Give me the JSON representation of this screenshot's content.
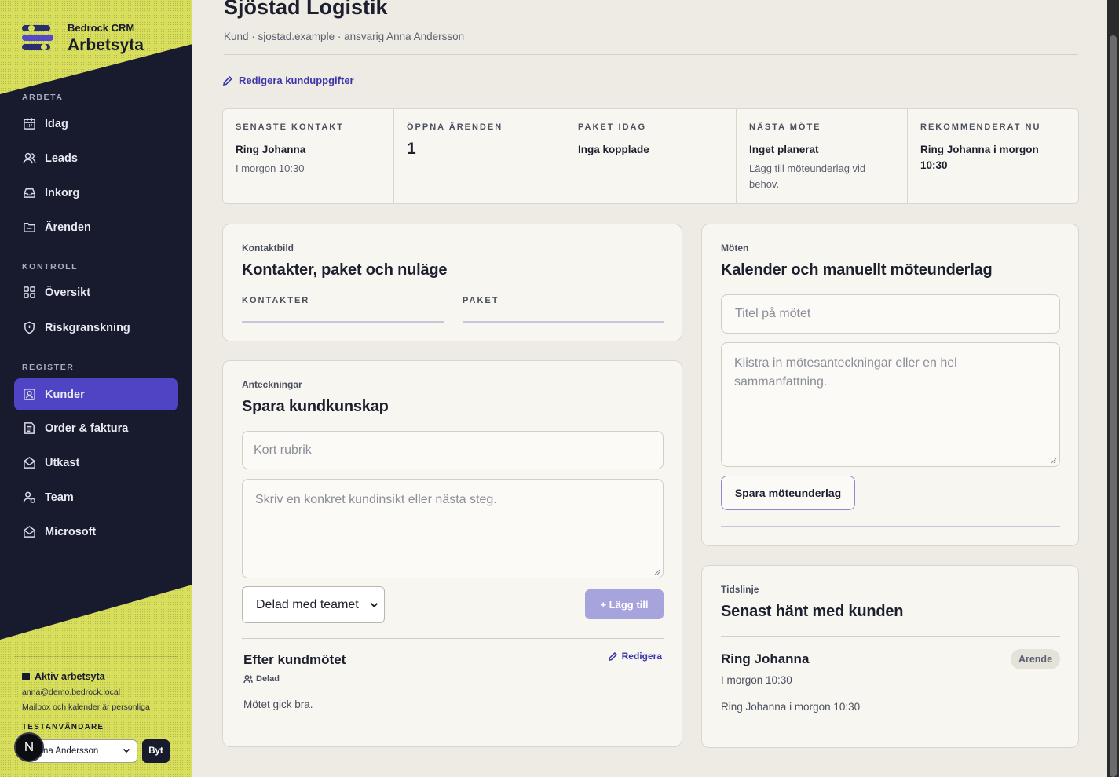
{
  "sidebar": {
    "brand_sub": "Bedrock CRM",
    "brand_title": "Arbetsyta",
    "sections": {
      "arbeta": "ARBETA",
      "kontroll": "KONTROLL",
      "register": "REGISTER"
    },
    "items": [
      {
        "label": "Idag",
        "icon": "calendar-icon"
      },
      {
        "label": "Leads",
        "icon": "users-icon"
      },
      {
        "label": "Inkorg",
        "icon": "inbox-icon"
      },
      {
        "label": "Ärenden",
        "icon": "folder-icon"
      },
      {
        "label": "Översikt",
        "icon": "grid-icon"
      },
      {
        "label": "Riskgranskning",
        "icon": "shield-icon"
      },
      {
        "label": "Kunder",
        "icon": "contact-card-icon",
        "active": true
      },
      {
        "label": "Order & faktura",
        "icon": "document-icon"
      },
      {
        "label": "Utkast",
        "icon": "envelope-icon"
      },
      {
        "label": "Team",
        "icon": "team-icon"
      },
      {
        "label": "Microsoft",
        "icon": "envelope-icon"
      }
    ],
    "workspace": {
      "active_label": "Aktiv arbetsyta",
      "email": "anna@demo.bedrock.local",
      "note": "Mailbox och kalender är personliga",
      "test_users_label": "TESTANVÄNDARE",
      "selected_user": "na Andersson",
      "switch_label": "Byt"
    },
    "badge_letter": "N"
  },
  "header": {
    "title": "Sjöstad Logistik",
    "subtitle": "Kund · sjostad.example · ansvarig Anna Andersson",
    "edit_link": "Redigera kunduppgifter"
  },
  "stats": [
    {
      "label": "SENASTE KONTAKT",
      "value": "Ring Johanna",
      "note": "I morgon 10:30"
    },
    {
      "label": "ÖPPNA ÄRENDEN",
      "value": "1",
      "note": ""
    },
    {
      "label": "PAKET IDAG",
      "value": "Inga kopplade",
      "note": ""
    },
    {
      "label": "NÄSTA MÖTE",
      "value": "Inget planerat",
      "note": "Lägg till möteunderlag vid behov."
    },
    {
      "label": "REKOMMENDERAT NU",
      "value": "Ring Johanna i morgon 10:30",
      "note": ""
    }
  ],
  "contacts_card": {
    "eyebrow": "Kontaktbild",
    "title": "Kontakter, paket och nuläge",
    "col_contacts": "KONTAKTER",
    "col_packages": "PAKET"
  },
  "notes_card": {
    "eyebrow": "Anteckningar",
    "title": "Spara kundkunskap",
    "heading_placeholder": "Kort rubrik",
    "body_placeholder": "Skriv en konkret kundinsikt eller nästa steg.",
    "visibility": "Delad med teamet",
    "add_button": "+ Lägg till",
    "note": {
      "title": "Efter kundmötet",
      "edit": "Redigera",
      "tag": "Delad",
      "body": "Mötet gick bra."
    }
  },
  "meetings_card": {
    "eyebrow": "Möten",
    "title": "Kalender och manuellt möteunderlag",
    "title_placeholder": "Titel på mötet",
    "notes_placeholder": "Klistra in mötesanteckningar eller en hel sammanfattning.",
    "save_button": "Spara möteunderlag"
  },
  "timeline_card": {
    "eyebrow": "Tidslinje",
    "title": "Senast hänt med kunden",
    "item": {
      "title": "Ring Johanna",
      "badge": "Arende",
      "time": "I morgon 10:30",
      "description": "Ring Johanna i morgon 10:30"
    }
  },
  "colors": {
    "sidebar_bg": "#181b2d",
    "accent": "#4f45c4",
    "lime": "#d8df5c",
    "page_bg": "#eeebe4"
  }
}
